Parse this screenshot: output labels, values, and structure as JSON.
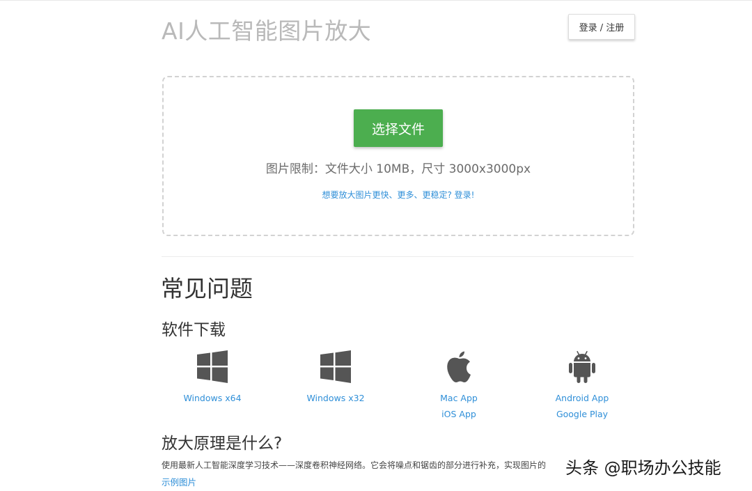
{
  "header": {
    "site_title": "AI人工智能图片放大",
    "login_label": "登录 / 注册"
  },
  "upload": {
    "choose_button": "选择文件",
    "limit_text": "图片限制：文件大小 10MB，尺寸 3000x3000px",
    "upsell_link": "想要放大图片更快、更多、更稳定? 登录!"
  },
  "faq": {
    "heading": "常见问题",
    "download": {
      "heading": "软件下载",
      "items": [
        {
          "icon": "windows-icon",
          "links": [
            "Windows x64"
          ]
        },
        {
          "icon": "windows-icon",
          "links": [
            "Windows x32"
          ]
        },
        {
          "icon": "apple-icon",
          "links": [
            "Mac App",
            "iOS App"
          ]
        },
        {
          "icon": "android-icon",
          "links": [
            "Android App",
            "Google Play"
          ]
        }
      ]
    },
    "principle": {
      "heading": "放大原理是什么?",
      "text": "使用最新人工智能深度学习技术——深度卷积神经网络。它会将噪点和锯齿的部分进行补充，实现图片的",
      "example_link": "示例图片"
    }
  },
  "watermark": "头条 @职场办公技能",
  "colors": {
    "accent_green": "#4cae4f",
    "link_blue": "#2f8fd8",
    "title_gray": "#b9b9b9",
    "icon_gray": "#555555"
  }
}
